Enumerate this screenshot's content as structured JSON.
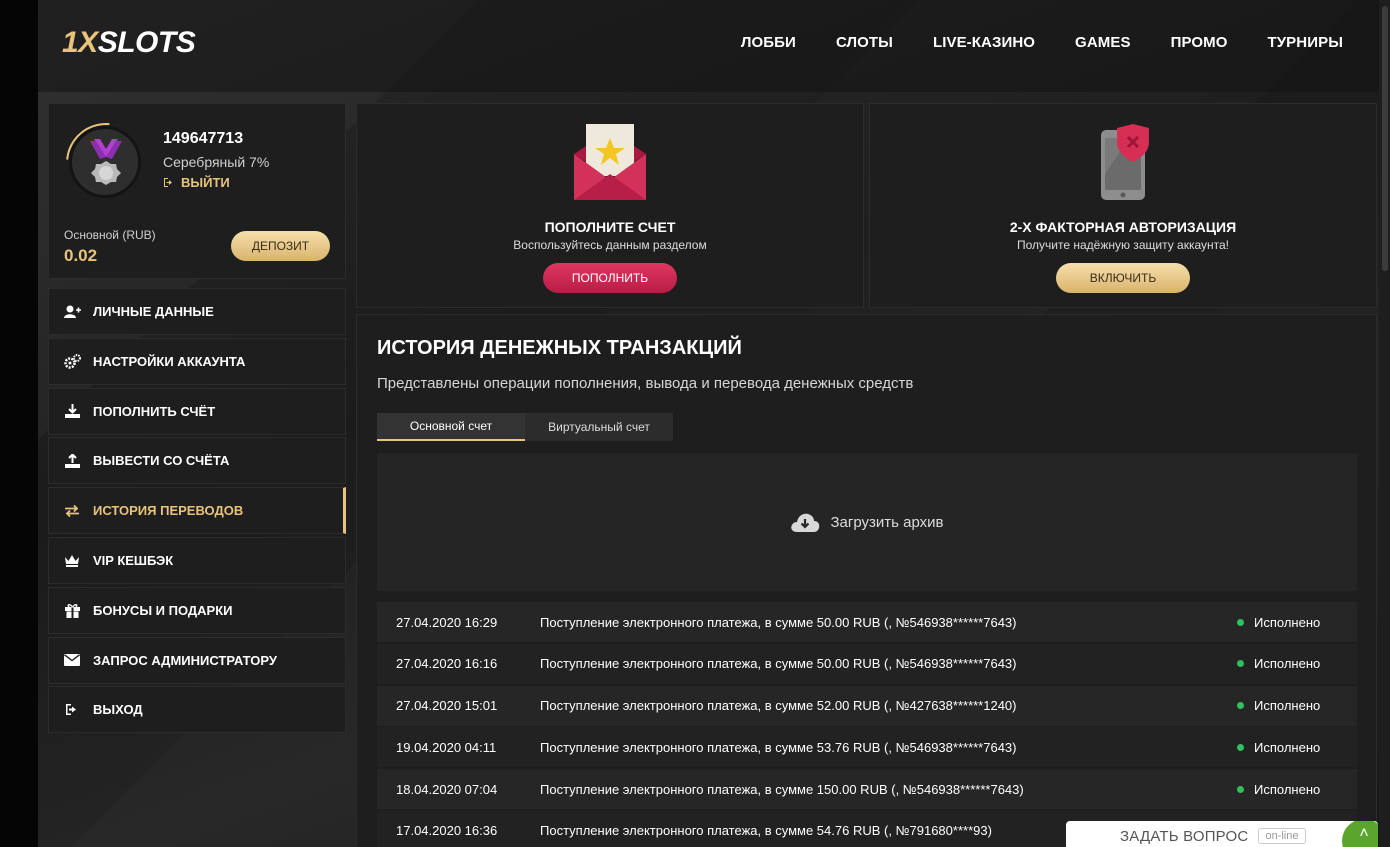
{
  "brand": {
    "logo_prefix": "1X",
    "logo_suffix": "SLOTS"
  },
  "nav": [
    {
      "label": "ЛОББИ"
    },
    {
      "label": "СЛОТЫ"
    },
    {
      "label": "LIVE-КАЗИНО"
    },
    {
      "label": "GAMES"
    },
    {
      "label": "ПРОМО"
    },
    {
      "label": "ТУРНИРЫ"
    }
  ],
  "profile": {
    "user_id": "149647713",
    "level": "Серебряный 7%",
    "logout_label": "ВЫЙТИ",
    "account_label": "Основной (RUB)",
    "balance": "0.02",
    "deposit_label": "ДЕПОЗИТ"
  },
  "menu": [
    {
      "label": "ЛИЧНЫЕ ДАННЫЕ",
      "icon": "user-plus-icon"
    },
    {
      "label": "НАСТРОЙКИ АККАУНТА",
      "icon": "gears-icon"
    },
    {
      "label": "ПОПОЛНИТЬ СЧЁТ",
      "icon": "download-icon"
    },
    {
      "label": "ВЫВЕСТИ СО СЧЁТА",
      "icon": "upload-icon"
    },
    {
      "label": "ИСТОРИЯ ПЕРЕВОДОВ",
      "icon": "exchange-icon",
      "active": true
    },
    {
      "label": "VIP КЕШБЭК",
      "icon": "crown-icon"
    },
    {
      "label": "БОНУСЫ И ПОДАРКИ",
      "icon": "gift-icon"
    },
    {
      "label": "ЗАПРОС АДМИНИСТРАТОРУ",
      "icon": "envelope-icon"
    },
    {
      "label": "ВЫХОД",
      "icon": "sign-out-icon"
    }
  ],
  "cards": {
    "deposit": {
      "title": "ПОПОЛНИТЕ СЧЕТ",
      "subtitle": "Воспользуйтесь данным разделом",
      "button": "ПОПОЛНИТЬ",
      "icon": "envelope-star-icon"
    },
    "twofa": {
      "title": "2-Х ФАКТОРНАЯ АВТОРИЗАЦИЯ",
      "subtitle": "Получите надёжную защиту аккаунта!",
      "button": "ВКЛЮЧИТЬ",
      "icon": "phone-shield-icon"
    }
  },
  "history": {
    "title": "ИСТОРИЯ ДЕНЕЖНЫХ ТРАНЗАКЦИЙ",
    "subtitle": "Представлены операции пополнения, вывода и перевода денежных средств",
    "tabs": [
      {
        "label": "Основной счет",
        "active": true
      },
      {
        "label": "Виртуальный счет"
      }
    ],
    "archive_label": "Загрузить архив",
    "rows": [
      {
        "datetime": "27.04.2020 16:29",
        "description": "Поступление электронного платежа, в сумме 50.00 RUB (, №546938******7643)",
        "status": "Исполнено"
      },
      {
        "datetime": "27.04.2020 16:16",
        "description": "Поступление электронного платежа, в сумме 50.00 RUB (, №546938******7643)",
        "status": "Исполнено"
      },
      {
        "datetime": "27.04.2020 15:01",
        "description": "Поступление электронного платежа, в сумме 52.00 RUB (, №427638******1240)",
        "status": "Исполнено"
      },
      {
        "datetime": "19.04.2020 04:11",
        "description": "Поступление электронного платежа, в сумме 53.76 RUB (, №546938******7643)",
        "status": "Исполнено"
      },
      {
        "datetime": "18.04.2020 07:04",
        "description": "Поступление электронного платежа, в сумме 150.00 RUB (, №546938******7643)",
        "status": "Исполнено"
      },
      {
        "datetime": "17.04.2020 16:36",
        "description": "Поступление электронного платежа, в сумме 54.76 RUB (, №791680****93)",
        "status": ""
      }
    ]
  },
  "ask_widget": {
    "label": "ЗАДАТЬ ВОПРОС",
    "badge": "on-line"
  },
  "colors": {
    "accent_gold": "#e8c37c",
    "accent_pink": "#c8234f",
    "status_green": "#2fc15b"
  }
}
